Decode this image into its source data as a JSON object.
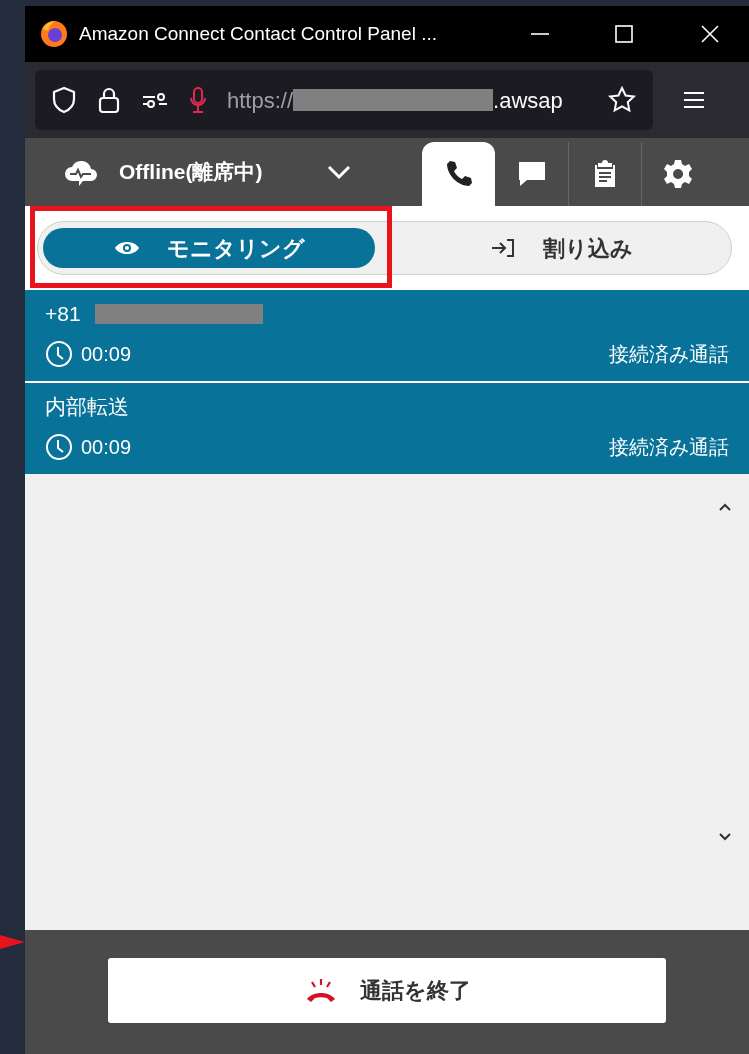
{
  "window": {
    "title": "Amazon Connect Contact Control Panel ..."
  },
  "address_bar": {
    "url_start": "https://",
    "url_end": ".awsap",
    "mic_active": true
  },
  "status": {
    "label": "Offline(離席中)"
  },
  "tabs": [
    {
      "kind": "phone",
      "selected": true
    },
    {
      "kind": "chat",
      "selected": false
    },
    {
      "kind": "clipboard",
      "selected": false
    },
    {
      "kind": "settings",
      "selected": false
    }
  ],
  "modes": [
    {
      "kind": "eye",
      "label": "モニタリング",
      "selected": true
    },
    {
      "kind": "barge",
      "label": "割り込み",
      "selected": false
    }
  ],
  "contacts": [
    {
      "name": "+81",
      "redacted": true,
      "time": "00:09",
      "state": "接続済み通話"
    },
    {
      "name": "内部転送",
      "redacted": false,
      "time": "00:09",
      "state": "接続済み通話"
    }
  ],
  "end_call": {
    "label": "通話を終了"
  }
}
